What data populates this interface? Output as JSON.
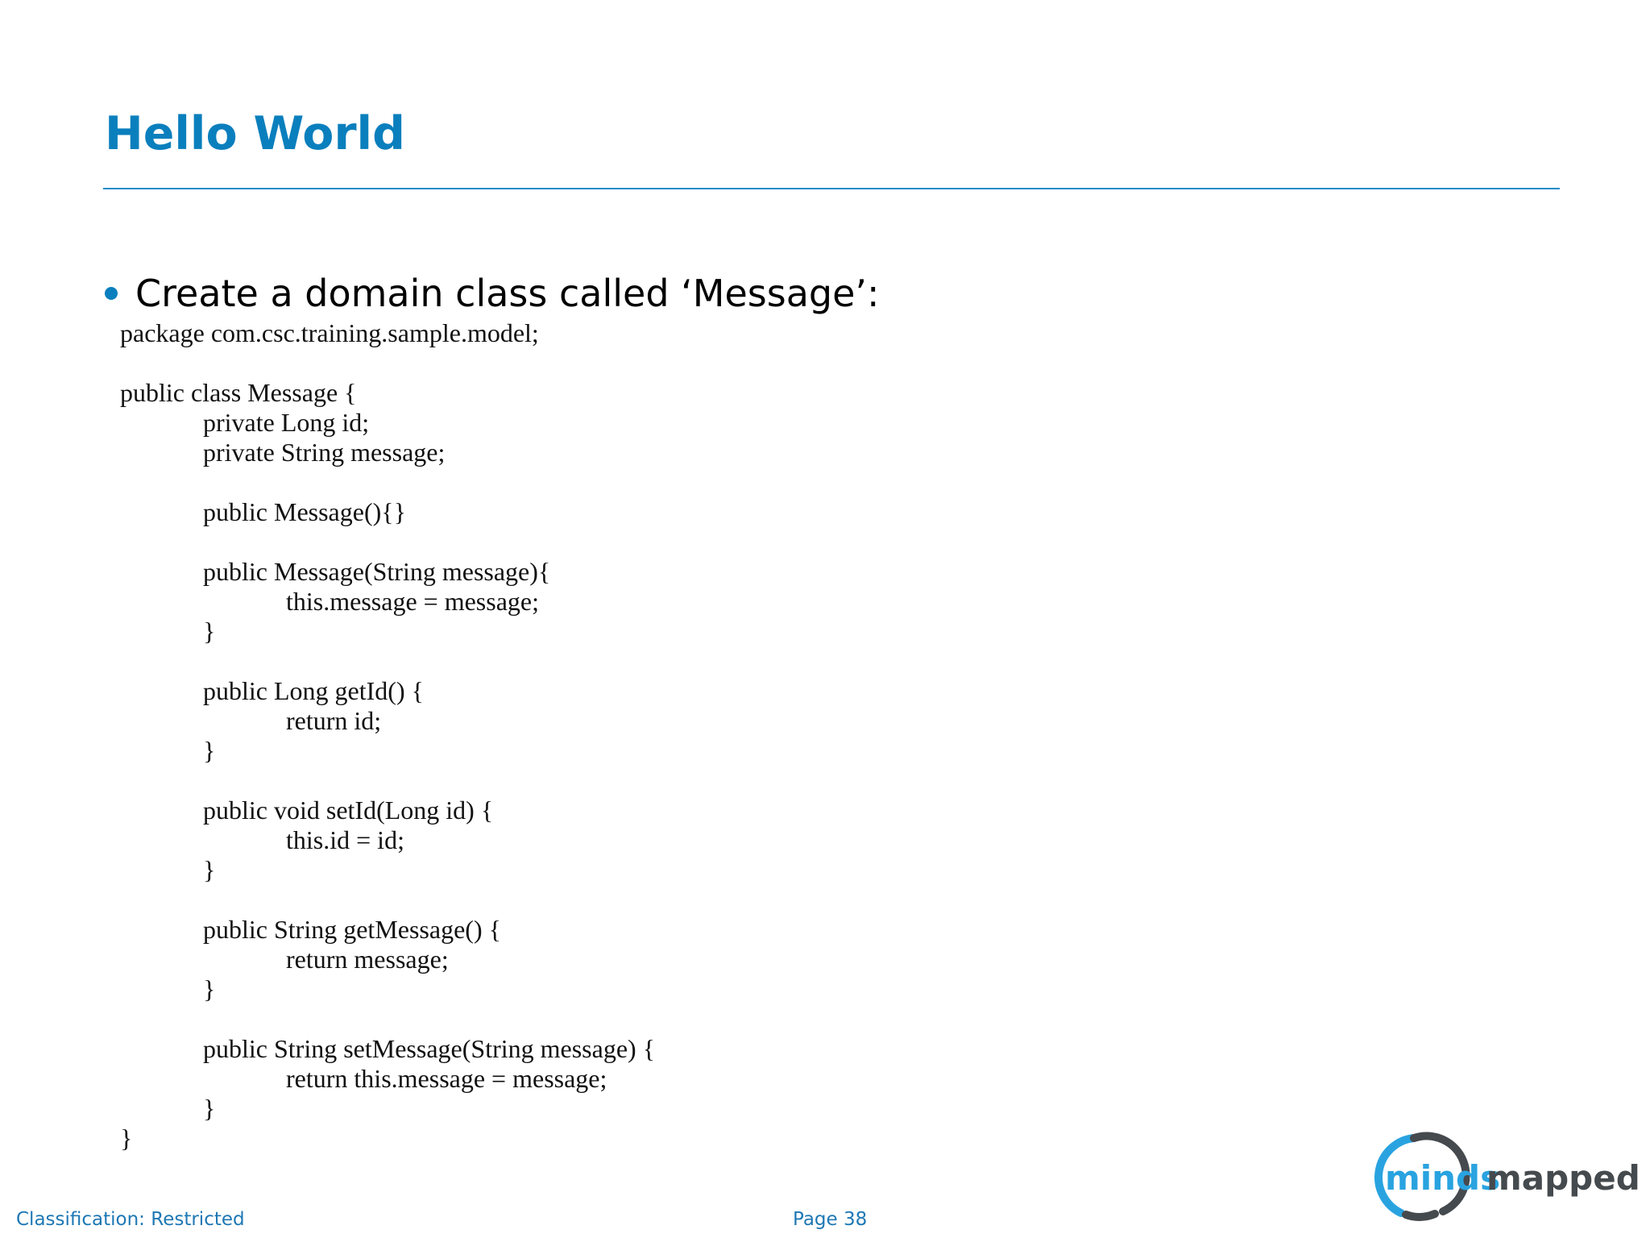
{
  "slide": {
    "title": "Hello World",
    "bullet": "Create a domain class called ‘Message’:"
  },
  "code": {
    "lines": [
      "package com.csc.training.sample.model;",
      "",
      "public class Message {",
      "private Long id;",
      "private String message;",
      "",
      "public Message(){}",
      "",
      "public Message(String message){",
      "this.message = message;",
      "}",
      "",
      "public Long getId() {",
      "return id;",
      "}",
      "",
      "public void setId(Long id) {",
      "this.id = id;",
      "}",
      "",
      "public String getMessage() {",
      "return message;",
      "}",
      "",
      "public String setMessage(String message) {",
      "return this.message = message;",
      "}",
      "}"
    ]
  },
  "footer": {
    "classification": "Classification: Restricted",
    "page": "Page 38"
  },
  "logo": {
    "text_main": "minds",
    "text_accent": "mapped"
  },
  "colors": {
    "title": "#0a7fbd",
    "rule": "#1f8cc8",
    "footer": "#1e78b4",
    "logo_blue": "#29a3e0",
    "logo_dark": "#454a4e"
  }
}
